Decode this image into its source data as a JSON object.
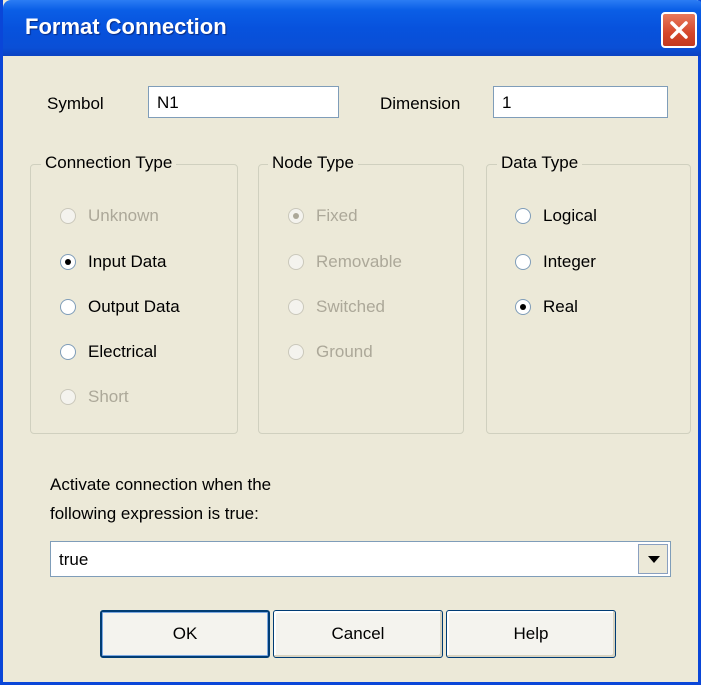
{
  "window": {
    "title": "Format Connection",
    "close_icon": "close-icon"
  },
  "fields": {
    "symbol_label": "Symbol",
    "symbol_value": "N1",
    "dimension_label": "Dimension",
    "dimension_value": "1"
  },
  "connection_type": {
    "legend": "Connection Type",
    "options": [
      {
        "label": "Unknown",
        "checked": false,
        "enabled": false
      },
      {
        "label": "Input Data",
        "checked": true,
        "enabled": true
      },
      {
        "label": "Output Data",
        "checked": false,
        "enabled": true
      },
      {
        "label": "Electrical",
        "checked": false,
        "enabled": true
      },
      {
        "label": "Short",
        "checked": false,
        "enabled": false
      }
    ]
  },
  "node_type": {
    "legend": "Node Type",
    "options": [
      {
        "label": "Fixed",
        "checked": true,
        "enabled": false
      },
      {
        "label": "Removable",
        "checked": false,
        "enabled": false
      },
      {
        "label": "Switched",
        "checked": false,
        "enabled": false
      },
      {
        "label": "Ground",
        "checked": false,
        "enabled": false
      }
    ]
  },
  "data_type": {
    "legend": "Data Type",
    "options": [
      {
        "label": "Logical",
        "checked": false,
        "enabled": true
      },
      {
        "label": "Integer",
        "checked": false,
        "enabled": true
      },
      {
        "label": "Real",
        "checked": true,
        "enabled": true
      }
    ]
  },
  "expression": {
    "prompt_line1": "Activate connection when the",
    "prompt_line2": "following expression is true:",
    "value": "true"
  },
  "buttons": {
    "ok": "OK",
    "cancel": "Cancel",
    "help": "Help"
  },
  "colors": {
    "titlebar": "#0752DD",
    "close": "#D5462A",
    "face": "#ECE9D8"
  }
}
